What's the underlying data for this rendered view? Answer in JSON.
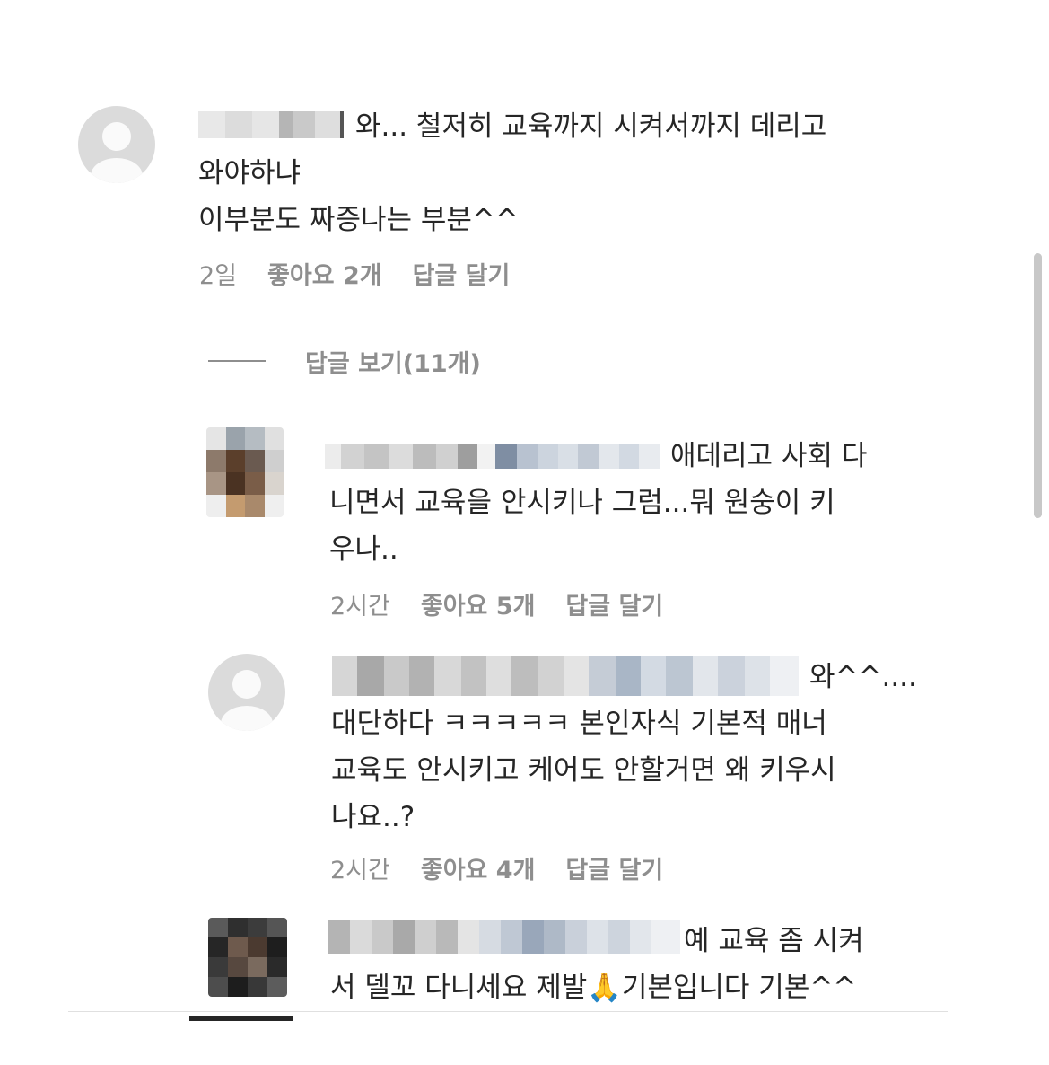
{
  "comments": [
    {
      "text": "와... 철저히 교육까지 시켜서까지 데리고\n와야하냐\n이부분도 짜증나는 부분^^",
      "time": "2일",
      "likes": "좋아요 2개",
      "reply": "답글 달기",
      "view_replies": "답글 보기(11개)"
    },
    {
      "text": "애데리고 사회 다\n니면서 교육을 안시키나 그럼...뭐 원숭이 키\n우나..",
      "time": "2시간",
      "likes": "좋아요 5개",
      "reply": "답글 달기"
    },
    {
      "text": "와^^....\n대단하다 ㅋㅋㅋㅋㅋ 본인자식 기본적 매너\n교육도 안시키고 케어도 안할거면 왜 키우시\n나요..?",
      "time": "2시간",
      "likes": "좋아요 4개",
      "reply": "답글 달기"
    },
    {
      "text": "예 교육 좀 시켜\n서 델꼬 다니세요 제발🙏기본입니다 기본^^"
    }
  ]
}
